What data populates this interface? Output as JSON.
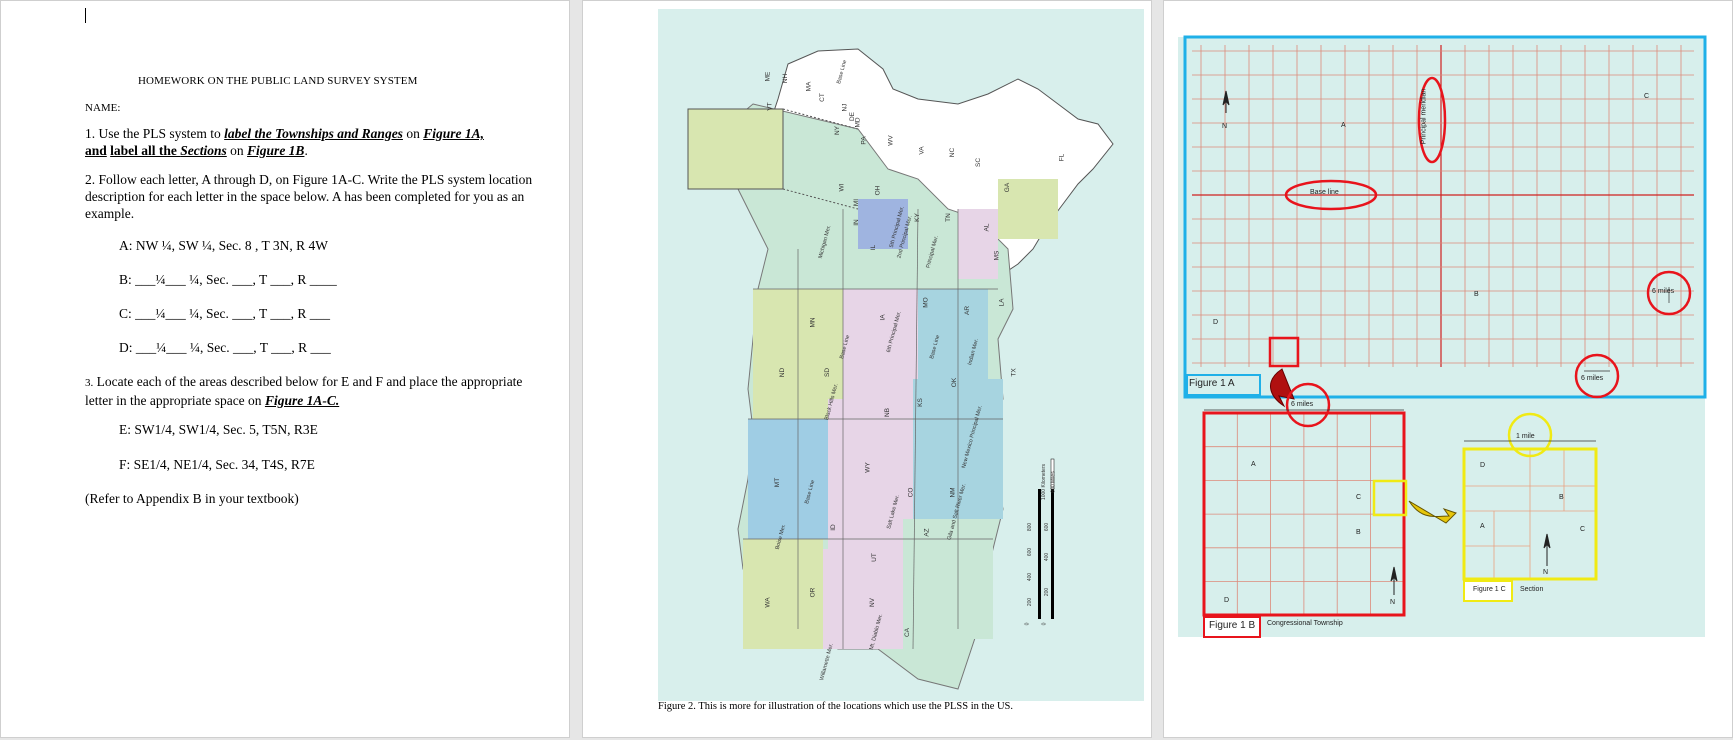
{
  "page1": {
    "title": "HOMEWORK ON THE PUBLIC LAND SURVEY SYSTEM",
    "name_label": "NAME:",
    "q1": {
      "num": "1.",
      "t1": " Use the PLS system to ",
      "t2": "label the Townships and Ranges",
      "t3": " on ",
      "t4": "Figure 1A,",
      "t5": "and",
      "t6": " ",
      "t7": "label all the ",
      "t8": "Sections",
      "t9": " on ",
      "t10": "Figure 1B",
      "t11": "."
    },
    "q2": {
      "text": "2.  Follow each letter, A through D, on Figure 1A-C.  Write the PLS system location description for each letter in the space below.  A has been completed for you as an example.",
      "answers": [
        "A:  NW ¼,  SW ¼, Sec.  8 , T 3N, R 4W",
        "B: ___¼___ ¼, Sec. ___, T ___, R ____",
        "C: ___¼___ ¼, Sec. ___, T ___, R ___",
        "D: ___¼___ ¼, Sec. ___, T ___, R ___"
      ]
    },
    "q3": {
      "num": "3.",
      "t1": " Locate each of the areas described below for E and F and place the appropriate letter in the appropriate space on ",
      "t2": "Figure 1A-C."
    },
    "e_line": "E:  SW1/4, SW1/4, Sec. 5, T5N, R3E",
    "f_line": "F:  SE1/4, NE1/4, Sec. 34, T4S, R7E",
    "ref": "(Refer to Appendix B in your textbook)"
  },
  "page2": {
    "caption": "Figure 2.  This is more for illustration of the locations which use the PLSS in the US.",
    "state_labels": [
      "ME",
      "NH",
      "MA",
      "CT",
      "VT",
      "NJ",
      "NY",
      "PA",
      "DE",
      "MD",
      "WV",
      "VA",
      "NC",
      "SC",
      "GA",
      "FL",
      "KY",
      "TN",
      "OH",
      "MI",
      "IN",
      "IL",
      "WI",
      "AL",
      "MS",
      "LA",
      "AR",
      "MO",
      "IA",
      "MN",
      "ND",
      "SD",
      "NB",
      "KS",
      "OK",
      "TX",
      "NM",
      "CO",
      "WY",
      "MT",
      "ID",
      "UT",
      "AZ",
      "NV",
      "CA",
      "OR",
      "WA"
    ],
    "meridian_labels": [
      "Base Line",
      "6th Principal Mer.",
      "Black Hills Mer.",
      "Principal Mer.",
      "Base Line",
      "Salt Lake Mer.",
      "Gila and Salt River Mer.",
      "Base Line",
      "Mt. Diablo Mer.",
      "Willamette Mer.",
      "Boise Mer.",
      "New Mexico Principal Mer.",
      "Indian Mer.",
      "5th Principal Mer.",
      "2nd Principal Mer.",
      "Michigan Mer.",
      "Base Line"
    ],
    "scale_labels": [
      "0",
      "200",
      "400",
      "600",
      "800 Miles",
      "0",
      "200",
      "400",
      "600",
      "800",
      "1000 Kilometers"
    ]
  },
  "page3": {
    "fig1a": {
      "label": "Figure 1 A",
      "baseline_label": "Base line",
      "meridian_label": "Principal meridian",
      "six_miles_right": "6 miles",
      "six_miles_bottom": "6 miles",
      "letters": [
        "A",
        "B",
        "C",
        "D"
      ],
      "north": "N"
    },
    "fig1b": {
      "label": "Figure 1 B",
      "caption": "Congressional Township",
      "six_miles_top": "6 miles",
      "letters": [
        "A",
        "B",
        "C",
        "D"
      ],
      "north": "N"
    },
    "fig1c": {
      "label": "Figure 1 C",
      "caption": "Section",
      "one_mile": "1 mile",
      "letters": [
        "A",
        "B",
        "C",
        "D"
      ],
      "north": "N"
    },
    "colors": {
      "blue_frame": "#1fb0e8",
      "red": "#e8141c",
      "yellow": "#f0ea14",
      "map_bg": "#d7efec"
    }
  }
}
